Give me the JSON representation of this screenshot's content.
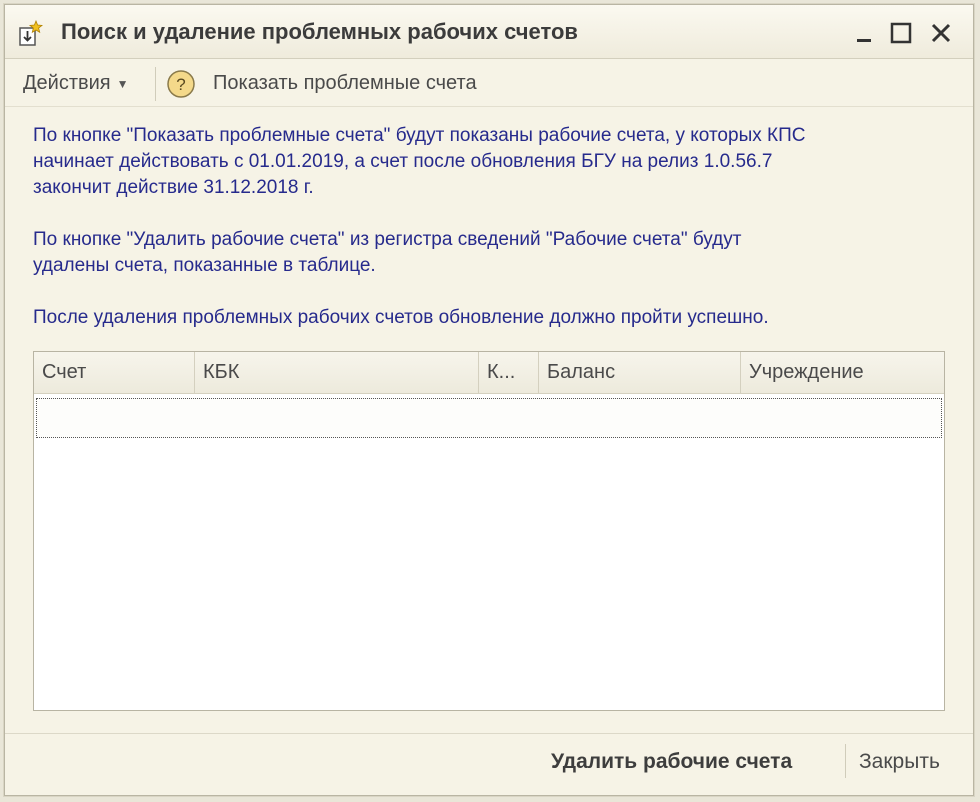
{
  "window": {
    "title": "Поиск и удаление проблемных рабочих счетов",
    "icon": "document-star-icon",
    "controls": [
      "minimize-icon",
      "maximize-icon",
      "close-icon"
    ]
  },
  "toolbar": {
    "actions_label": "Действия",
    "help_symbol": "?",
    "show_label": "Показать проблемные счета"
  },
  "info": {
    "paragraph1_line1": "По кнопке \"Показать проблемные счета\" будут показаны рабочие счета, у которых КПС",
    "paragraph1_line2": "начинает действовать с 01.01.2019, а счет после обновления БГУ на релиз 1.0.56.7",
    "paragraph1_line3": "закончит действие 31.12.2018 г.",
    "paragraph2_line1": "По кнопке \"Удалить рабочие счета\" из регистра сведений \"Рабочие счета\" будут",
    "paragraph2_line2": "удалены счета, показанные в таблице.",
    "paragraph3": "После удаления проблемных рабочих счетов обновление должно пройти успешно."
  },
  "table": {
    "columns": [
      "Счет",
      "КБК",
      "К...",
      "Баланс",
      "Учреждение"
    ],
    "rows": []
  },
  "footer": {
    "delete_label": "Удалить рабочие счета",
    "close_label": "Закрыть"
  },
  "colors": {
    "info_text": "#262a8c",
    "window_bg": "#f6f3e6",
    "help_icon_fill": "#f4d98a"
  }
}
